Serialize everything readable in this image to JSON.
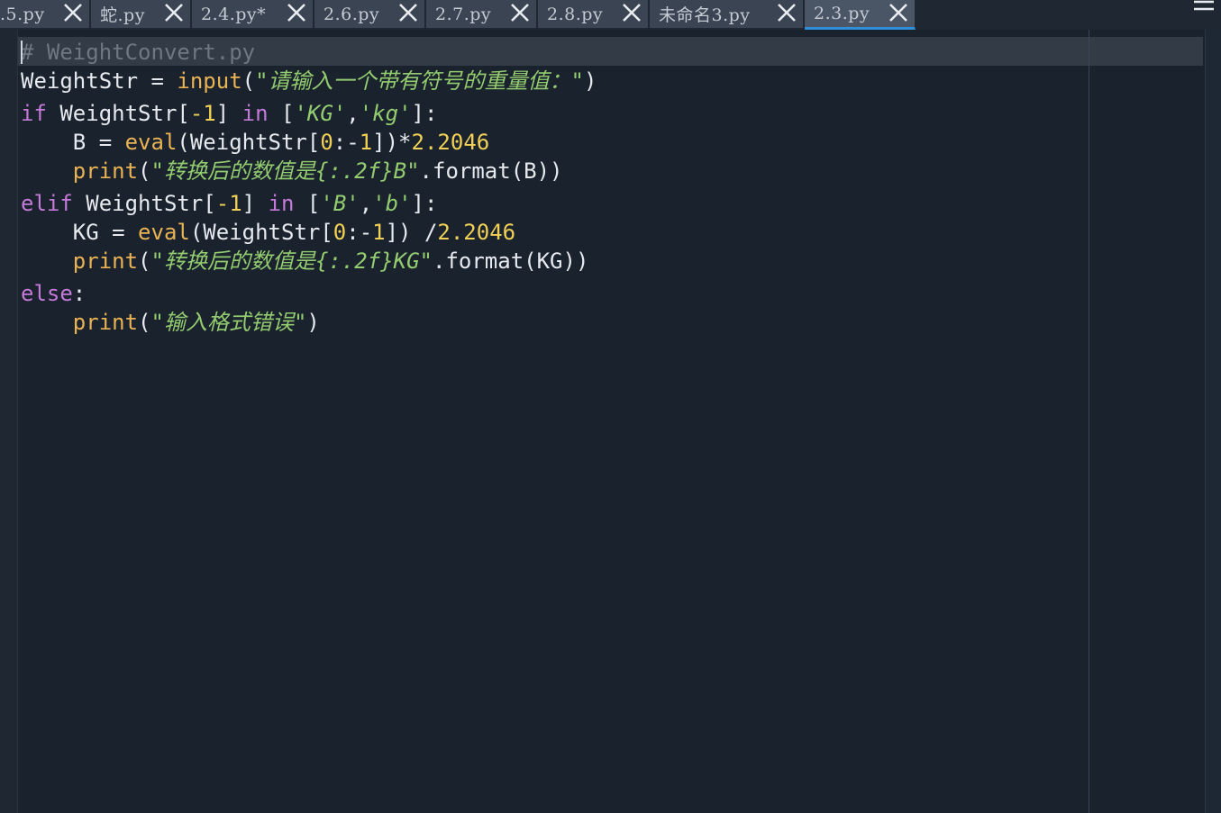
{
  "tabs": [
    {
      "label": ".5.py",
      "active": false
    },
    {
      "label": "蛇.py",
      "active": false
    },
    {
      "label": "2.4.py*",
      "active": false
    },
    {
      "label": "2.6.py",
      "active": false
    },
    {
      "label": "2.7.py",
      "active": false
    },
    {
      "label": "2.8.py",
      "active": false
    },
    {
      "label": "未命名3.py",
      "active": false
    },
    {
      "label": "2.3.py",
      "active": true
    }
  ],
  "colors": {
    "background": "#1a222d",
    "keyword": "#c57ad9",
    "builtin": "#e9b354",
    "string": "#93cc6f",
    "number": "#f0d055",
    "comment": "#6e7782",
    "active_tab_accent": "#2f8fd8"
  },
  "icons": {
    "tab_close": "close-icon",
    "menu": "hamburger-menu-icon"
  },
  "code": {
    "l1": {
      "comment": "# WeightConvert.py"
    },
    "l2": {
      "var": "WeightStr",
      "op": " = ",
      "fn": "input",
      "open": "(",
      "str": "\"请输入一个带有符号的重量值：\"",
      "close": ")"
    },
    "l3": {
      "kw": "if",
      "a": " WeightStr[",
      "n1": "-1",
      "b": "] ",
      "kw2": "in",
      "c": " [",
      "s1": "'KG'",
      "comma": ",",
      "s2": "'kg'",
      "d": "]:"
    },
    "l4": {
      "indent": "    ",
      "a": "B = ",
      "fn": "eval",
      "b": "(WeightStr[",
      "n1": "0",
      "c": ":-",
      "n2": "1",
      "d": "])*",
      "n3": "2.2046"
    },
    "l5": {
      "indent": "    ",
      "fn": "print",
      "a": "(",
      "str": "\"转换后的数值是{:.2f}B\"",
      "b": ".format(B))"
    },
    "l6": {
      "kw": "elif",
      "a": " WeightStr[",
      "n1": "-1",
      "b": "] ",
      "kw2": "in",
      "c": " [",
      "s1": "'B'",
      "comma": ",",
      "s2": "'b'",
      "d": "]:"
    },
    "l7": {
      "indent": "    ",
      "a": "KG = ",
      "fn": "eval",
      "b": "(WeightStr[",
      "n1": "0",
      "c": ":-",
      "n2": "1",
      "d": "]) /",
      "n3": "2.2046"
    },
    "l8": {
      "indent": "    ",
      "fn": "print",
      "a": "(",
      "str": "\"转换后的数值是{:.2f}KG\"",
      "b": ".format(KG))"
    },
    "l9": {
      "kw": "else",
      "a": ":"
    },
    "l10": {
      "indent": "    ",
      "fn": "print",
      "a": "(",
      "str": "\"输入格式错误\"",
      "b": ")"
    }
  }
}
